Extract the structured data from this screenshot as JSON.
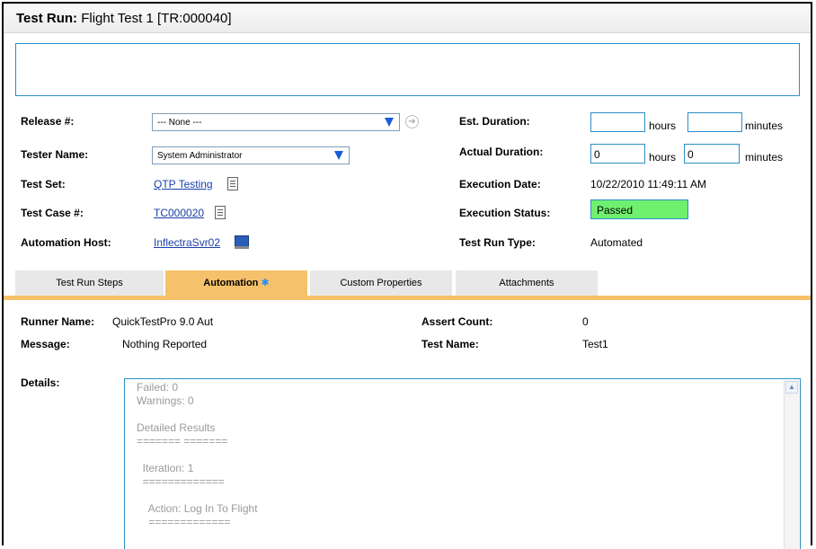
{
  "title": {
    "label": "Test Run:",
    "text": "Flight Test 1 [TR:000040]"
  },
  "fields": {
    "release": {
      "label": "Release #:",
      "value": "--- None ---"
    },
    "tester": {
      "label": "Tester Name:",
      "value": "System Administrator"
    },
    "test_set": {
      "label": "Test Set:",
      "value": "QTP Testing"
    },
    "test_case": {
      "label": "Test Case #:",
      "value": "TC000020"
    },
    "automation_host": {
      "label": "Automation Host:",
      "value": "InflectraSvr02"
    },
    "est_duration": {
      "label": "Est. Duration:",
      "hours": "",
      "minutes": "",
      "hours_label": "hours",
      "minutes_label": "minutes"
    },
    "actual_duration": {
      "label": "Actual Duration:",
      "hours": "0",
      "minutes": "0",
      "hours_label": "hours",
      "minutes_label": "minutes"
    },
    "execution_date": {
      "label": "Execution Date:",
      "value": "10/22/2010 11:49:11 AM"
    },
    "execution_status": {
      "label": "Execution Status:",
      "value": "Passed",
      "color": "#6ff06f"
    },
    "test_run_type": {
      "label": "Test Run Type:",
      "value": "Automated"
    }
  },
  "tabs": [
    {
      "label": "Test Run Steps",
      "active": false
    },
    {
      "label": "Automation",
      "active": true,
      "marker": "✱"
    },
    {
      "label": "Custom Properties",
      "active": false
    },
    {
      "label": "Attachments",
      "active": false
    }
  ],
  "automation": {
    "runner_name": {
      "label": "Runner Name:",
      "value": "QuickTestPro 9.0 Aut"
    },
    "message": {
      "label": "Message:",
      "value": "Nothing Reported"
    },
    "assert_count": {
      "label": "Assert Count:",
      "value": "0"
    },
    "test_name": {
      "label": "Test Name:",
      "value": "Test1"
    },
    "details_label": "Details:",
    "details_lines": [
      "Failed: 0",
      "Warnings: 0",
      "",
      "Detailed Results",
      "======= =======",
      "",
      "  Iteration: 1",
      "  =============",
      "",
      "    Action: Log In To Flight",
      "    ============="
    ]
  },
  "colors": {
    "accent": "#f5c26b",
    "border": "#2b8fc6",
    "link": "#1a3ea8"
  }
}
